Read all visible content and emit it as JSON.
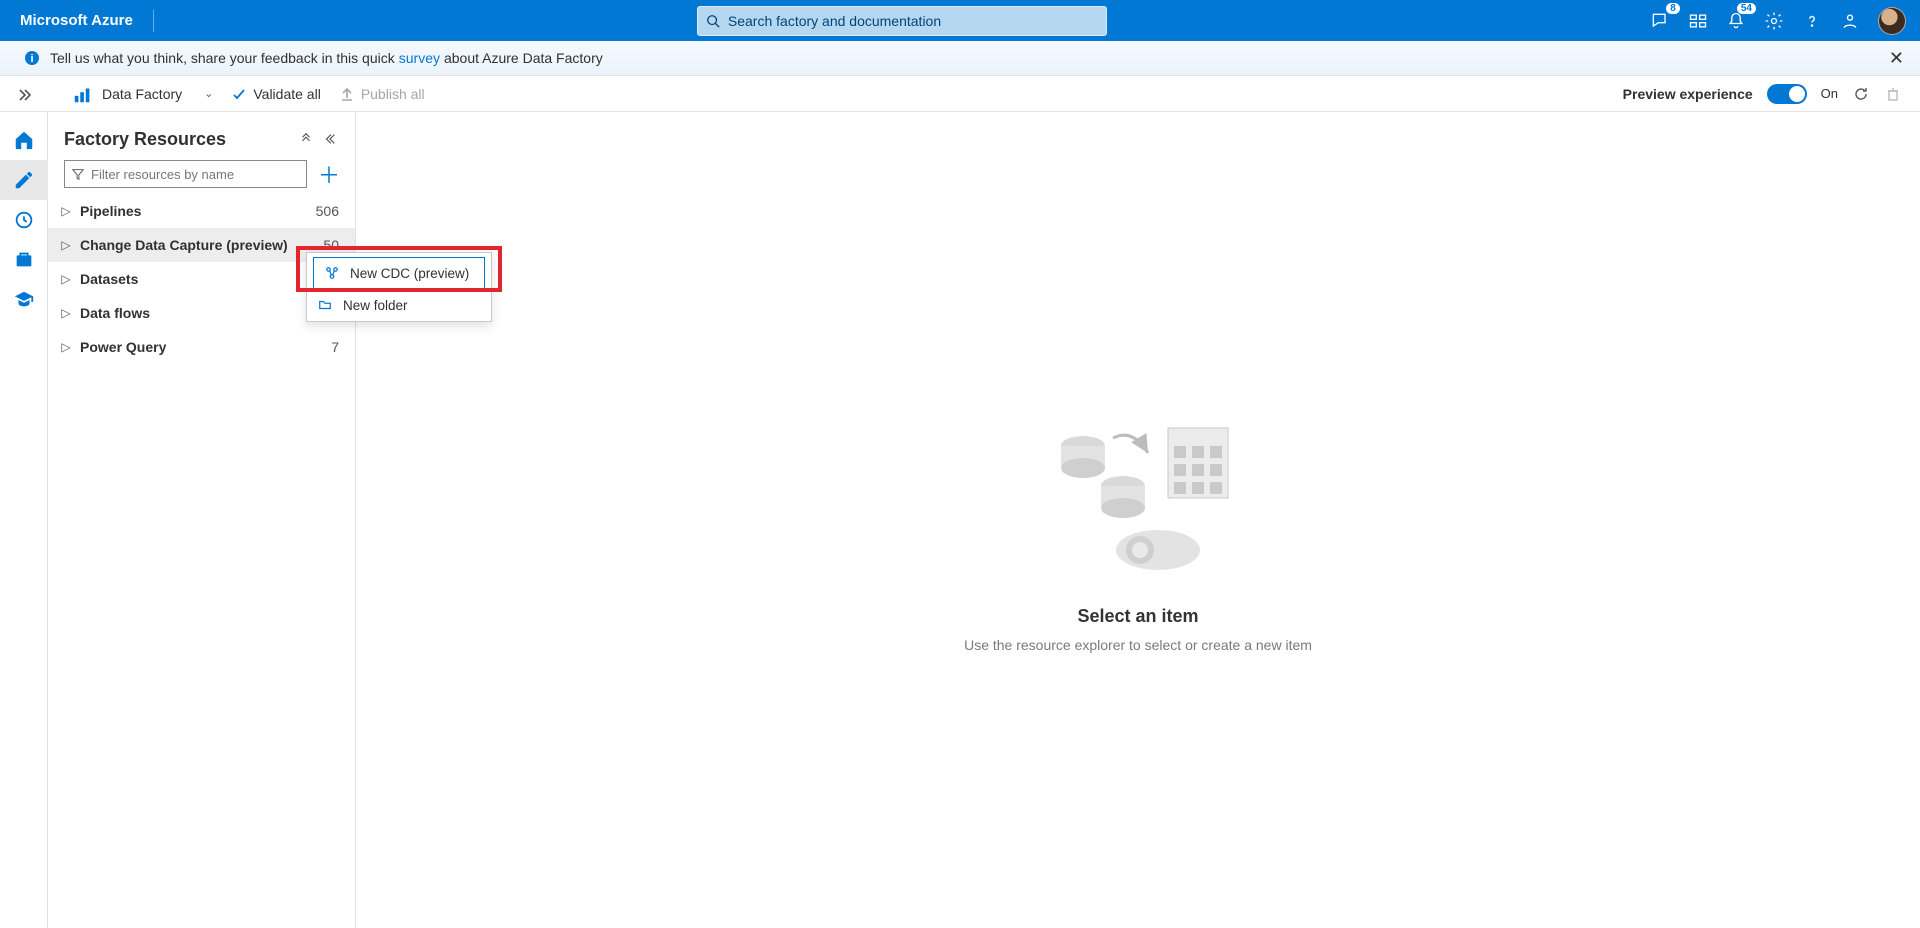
{
  "header": {
    "brand": "Microsoft Azure",
    "search_placeholder": "Search factory and documentation",
    "badges": {
      "feedback": "8",
      "notifications": "54"
    }
  },
  "banner": {
    "pre": "Tell us what you think, share your feedback in this quick",
    "link": "survey",
    "post": "about Azure Data Factory"
  },
  "toolbar": {
    "factory_label": "Data Factory",
    "validate": "Validate all",
    "publish": "Publish all",
    "preview_label": "Preview experience",
    "toggle_state": "On"
  },
  "explorer": {
    "title": "Factory Resources",
    "filter_placeholder": "Filter resources by name",
    "items": [
      {
        "label": "Pipelines",
        "count": "506"
      },
      {
        "label": "Change Data Capture (preview)",
        "count": "50"
      },
      {
        "label": "Datasets",
        "count": ""
      },
      {
        "label": "Data flows",
        "count": ""
      },
      {
        "label": "Power Query",
        "count": "7"
      }
    ]
  },
  "context_menu": {
    "new_cdc": "New CDC (preview)",
    "new_folder": "New folder"
  },
  "canvas": {
    "title": "Select an item",
    "subtitle": "Use the resource explorer to select or create a new item"
  }
}
